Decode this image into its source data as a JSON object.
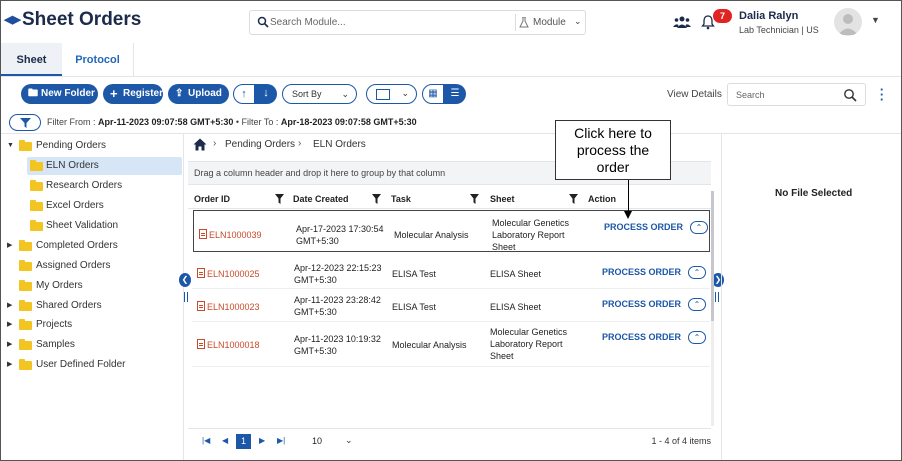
{
  "header": {
    "app_title": "Sheet Orders",
    "search_placeholder": "Search Module...",
    "module_label": "Module",
    "notification_count": "7",
    "user_name": "Dalia Ralyn",
    "user_role": "Lab Technician | US"
  },
  "tabs": [
    {
      "label": "Sheet",
      "active": true
    },
    {
      "label": "Protocol",
      "active": false
    }
  ],
  "toolbar": {
    "new_folder": "New Folder",
    "register": "Register",
    "upload": "Upload",
    "sort_by": "Sort By",
    "view_details": "View Details",
    "search_placeholder": "Search"
  },
  "filter": {
    "from_label": "Filter From :",
    "from_value": "Apr-11-2023 09:07:58 GMT+5:30",
    "to_label": "Filter To :",
    "to_value": "Apr-18-2023 09:07:58 GMT+5:30"
  },
  "sidebar": {
    "items": [
      {
        "label": "Pending Orders",
        "expanded": true
      },
      {
        "label": "ELN Orders",
        "selected": true
      },
      {
        "label": "Research Orders"
      },
      {
        "label": "Excel Orders"
      },
      {
        "label": "Sheet Validation"
      },
      {
        "label": "Completed Orders"
      },
      {
        "label": "Assigned Orders"
      },
      {
        "label": "My Orders"
      },
      {
        "label": "Shared Orders"
      },
      {
        "label": "Projects"
      },
      {
        "label": "Samples"
      },
      {
        "label": "User Defined Folder"
      }
    ]
  },
  "breadcrumb": {
    "items": [
      "Pending Orders",
      "ELN Orders"
    ]
  },
  "group_hint": "Drag a column header and drop it here to group by that column",
  "table": {
    "columns": [
      "Order ID",
      "Date Created",
      "Task",
      "Sheet",
      "Action"
    ],
    "rows": [
      {
        "order_id": "ELN1000039",
        "date_line1": "Apr-17-2023 17:30:54",
        "date_line2": "GMT+5:30",
        "task": "Molecular Analysis",
        "sheet_line1": "Molecular Genetics",
        "sheet_line2": "Laboratory Report",
        "sheet_line3": "Sheet",
        "action": "PROCESS ORDER"
      },
      {
        "order_id": "ELN1000025",
        "date_line1": "Apr-12-2023 22:15:23",
        "date_line2": "GMT+5:30",
        "task": "ELISA Test",
        "sheet_line1": "ELISA Sheet",
        "sheet_line2": "",
        "sheet_line3": "",
        "action": "PROCESS ORDER"
      },
      {
        "order_id": "ELN1000023",
        "date_line1": "Apr-11-2023 23:28:42",
        "date_line2": "GMT+5:30",
        "task": "ELISA Test",
        "sheet_line1": "ELISA Sheet",
        "sheet_line2": "",
        "sheet_line3": "",
        "action": "PROCESS ORDER"
      },
      {
        "order_id": "ELN1000018",
        "date_line1": "Apr-11-2023 10:19:32",
        "date_line2": "GMT+5:30",
        "task": "Molecular Analysis",
        "sheet_line1": "Molecular Genetics",
        "sheet_line2": "Laboratory Report",
        "sheet_line3": "Sheet",
        "action": "PROCESS ORDER"
      }
    ]
  },
  "pager": {
    "current_page": "1",
    "page_size": "10",
    "info": "1 - 4 of 4 items"
  },
  "right_panel": {
    "empty_text": "No File Selected"
  },
  "callout": {
    "line1": "Click here to",
    "line2": "process the",
    "line3": "order"
  }
}
